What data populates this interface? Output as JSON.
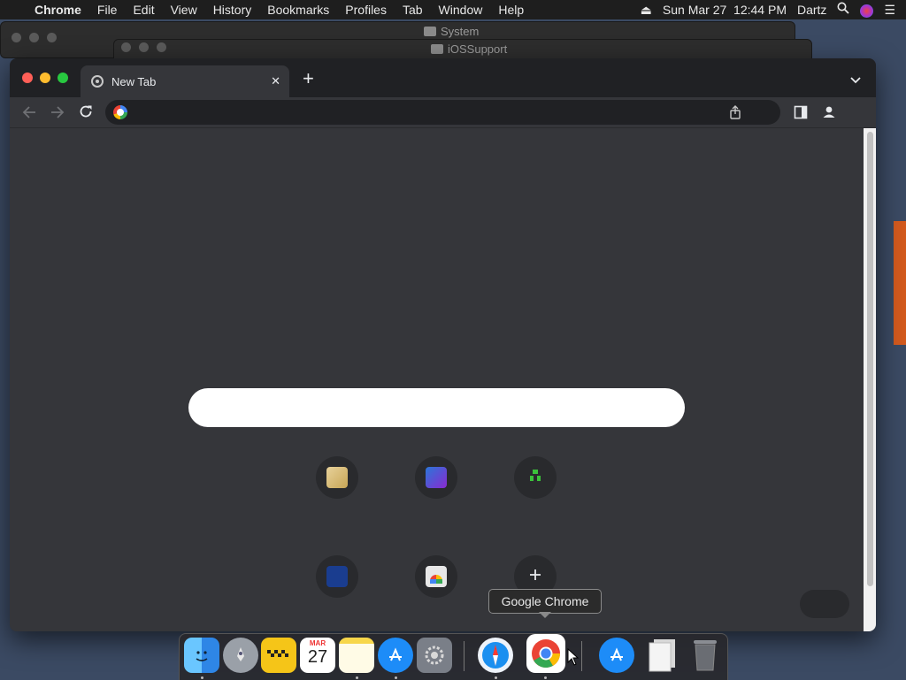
{
  "menubar": {
    "app_name": "Chrome",
    "menus": [
      "File",
      "Edit",
      "View",
      "History",
      "Bookmarks",
      "Profiles",
      "Tab",
      "Window",
      "Help"
    ],
    "datetime": "Sun Mar 27  12:44 PM",
    "user": "Dartz"
  },
  "background_windows": {
    "finder_title_1": "System",
    "finder_title_2": "iOSSupport"
  },
  "browser": {
    "tab_title": "New Tab",
    "tab_close": "✕",
    "new_tab_symbol": "+"
  },
  "calendar_icon": {
    "month": "MAR",
    "day": "27"
  },
  "tooltip": {
    "text": "Google Chrome"
  },
  "colors": {
    "accent_chrome_dark": "#35363a",
    "tabstrip": "#202124",
    "close_red": "#ff5f57",
    "minimize_yellow": "#febc2e",
    "zoom_green": "#28c840"
  }
}
